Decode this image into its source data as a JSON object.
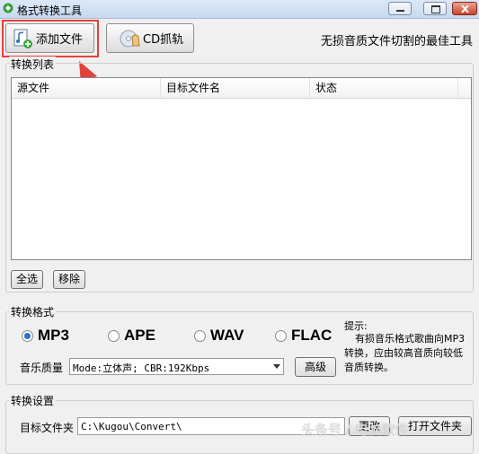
{
  "window": {
    "title": "格式转换工具"
  },
  "toolbar": {
    "add_file_label": "添加文件",
    "cd_rip_label": "CD抓轨",
    "slogan": "无损音质文件切割的最佳工具"
  },
  "convert_list": {
    "group_title": "转换列表",
    "columns": [
      "源文件",
      "目标文件名",
      "状态"
    ],
    "select_all_label": "全选",
    "remove_label": "移除"
  },
  "format": {
    "group_title": "转换格式",
    "options": [
      {
        "label": "MP3",
        "selected": true
      },
      {
        "label": "APE",
        "selected": false
      },
      {
        "label": "WAV",
        "selected": false
      },
      {
        "label": "FLAC",
        "selected": false
      }
    ],
    "quality_label": "音乐质量",
    "quality_value": "Mode:立体声; CBR:192Kbps",
    "advanced_label": "高级",
    "tip_title": "提示:",
    "tip_text": "有损音乐格式歌曲向MP3转换，应由较高音质向较低音质转换。"
  },
  "settings": {
    "group_title": "转换设置",
    "target_folder_label": "目标文件夹",
    "target_folder_value": "C:\\Kugou\\Convert\\",
    "change_label": "更改",
    "open_folder_label": "打开文件夹"
  },
  "watermark": "头条号 / 电脑软件"
}
